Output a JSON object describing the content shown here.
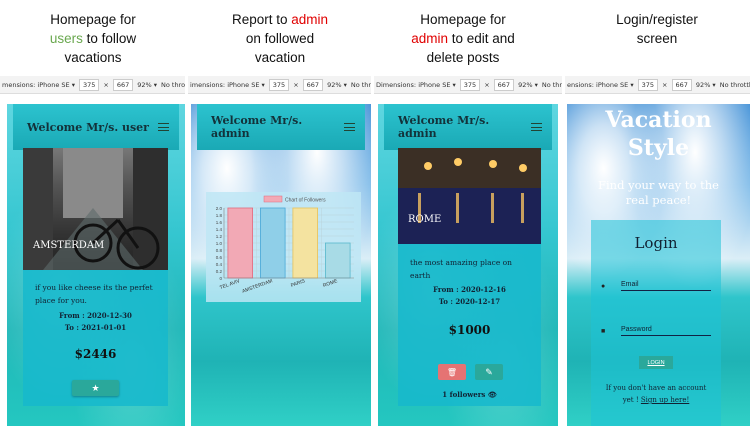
{
  "captions": {
    "c1": {
      "l1": "Homepage for",
      "l2a": "users",
      "l2b": " to follow",
      "l3": "vacations"
    },
    "c2": {
      "l1a": "Report to ",
      "l1b": "admin",
      "l2": "on followed",
      "l3": "vacation"
    },
    "c3": {
      "l1": "Homepage for",
      "l2a": "admin",
      "l2b": " to edit and",
      "l3": "delete posts"
    },
    "c4": {
      "l1": "Login/register",
      "l2": "screen"
    }
  },
  "devbar": {
    "b1": {
      "device": "mensions: iPhone SE ▾",
      "w": "375",
      "x": "×",
      "h": "667",
      "zoom": "92% ▾",
      "throttle": "No throttling"
    },
    "b2": {
      "device": "imensions: iPhone SE ▾",
      "w": "375",
      "x": "×",
      "h": "667",
      "zoom": "92% ▾",
      "throttle": "No throttli"
    },
    "b3": {
      "device": "Dimensions: iPhone SE ▾",
      "w": "375",
      "x": "×",
      "h": "667",
      "zoom": "92% ▾",
      "throttle": "No throttlin"
    },
    "b4": {
      "device": "ensions: iPhone SE ▾",
      "w": "375",
      "x": "×",
      "h": "667",
      "zoom": "92% ▾",
      "throttle": "No throttli"
    }
  },
  "screen1": {
    "title": "Welcome Mr/s. user",
    "place": "AMSTERDAM",
    "description": "if you like cheese its the perfet place for you.",
    "from": "From : 2020-12-30",
    "to": "To : 2021-01-01",
    "price": "$2446",
    "follow_icon": "★"
  },
  "screen2": {
    "title": "Welcome Mr/s. admin"
  },
  "screen3": {
    "title": "Welcome Mr/s. admin",
    "place": "ROME",
    "description": "the most amazing place on earth",
    "from": "From : 2020-12-16",
    "to": "To : 2020-12-17",
    "price": "$1000",
    "delete_icon": "🗑",
    "edit_icon": "✎",
    "followers": "1 followers",
    "eye_icon": "👁"
  },
  "screen4": {
    "brand1": "Vacation",
    "brand2": "Style",
    "tagline1": "Find your way to the",
    "tagline2": "real peace!",
    "login_title": "Login",
    "email_placeholder": "Email",
    "password_placeholder": "Password",
    "login_button": "LOGIN",
    "no_account": "If you don't have an account",
    "yet": "yet ! ",
    "signup": "Sign up here!"
  },
  "chart_data": {
    "type": "bar",
    "title": "Chart of Followers",
    "legend_position": "top",
    "categories": [
      "TEL AVIV",
      "AMSTERDAM",
      "PARIS",
      "ROME"
    ],
    "series": [
      {
        "name": "Chart of Followers",
        "values": [
          2,
          2,
          2,
          1
        ]
      }
    ],
    "bar_colors": [
      "#f2a9b5",
      "#8fcfe8",
      "#f4e3a0",
      "#a8dbe6"
    ],
    "bar_borders": [
      "#e06b7f",
      "#4aa8d8",
      "#e6c25a",
      "#59b8cc"
    ],
    "ylim": [
      0,
      2.0
    ],
    "yticks": [
      "0",
      "0.2",
      "0.4",
      "0.6",
      "0.8",
      "1.0",
      "1.2",
      "1.4",
      "1.6",
      "1.8",
      "2.0"
    ],
    "grid": true
  }
}
